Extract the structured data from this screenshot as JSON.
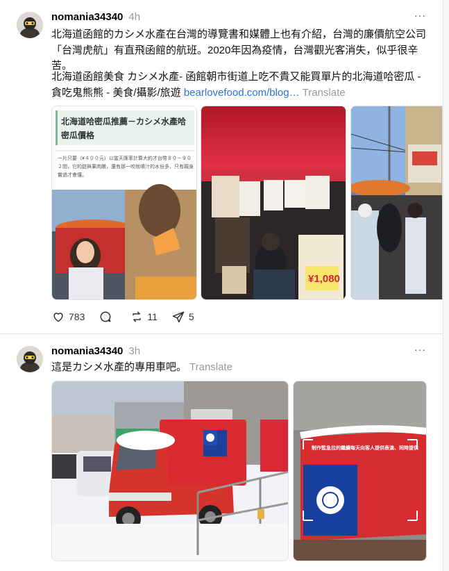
{
  "posts": [
    {
      "username": "nomania34340",
      "time": "4h",
      "more": "···",
      "paragraph1": "北海道函館的カシメ水產在台灣的導覽書和媒體上也有介紹，台灣的廉價航空公司「台灣虎航」有直飛函館的航班。2020年因為疫情，台灣觀光客消失，似乎很辛苦。",
      "paragraph2_text": "北海道函館美食 カシメ水產- 函館朝市街道上吃不貴又能買單片的北海道哈密瓜 - 貪吃鬼熊熊 - 美食/攝影/旅遊 ",
      "link": "bearlovefood.com/blog…",
      "translate": "Translate",
      "image1": {
        "heading": "北海道哈密瓜推薦－カシメ水產哈密瓜價格",
        "body": "一片只要（¥４００元）以當天匯率計算大約才台幣８０－９０２間，它的甜與果肉嫩，還有那一咬就噴汁的水份多，只有親身嘗過才會懂。"
      },
      "image2": {
        "price": "¥1,080"
      },
      "likes": "783",
      "comments": "",
      "reposts": "11",
      "shares": "5"
    },
    {
      "username": "nomania34340",
      "time": "3h",
      "more": "···",
      "text": "這是カシメ水產的專用車吧。",
      "translate": "Translate",
      "image2": {
        "banner": "制作監急拉的繼續每天向客人提供表演、同時提供"
      }
    }
  ],
  "colors": {
    "link": "#2e6fdb",
    "muted": "#999999",
    "text": "#111111"
  }
}
